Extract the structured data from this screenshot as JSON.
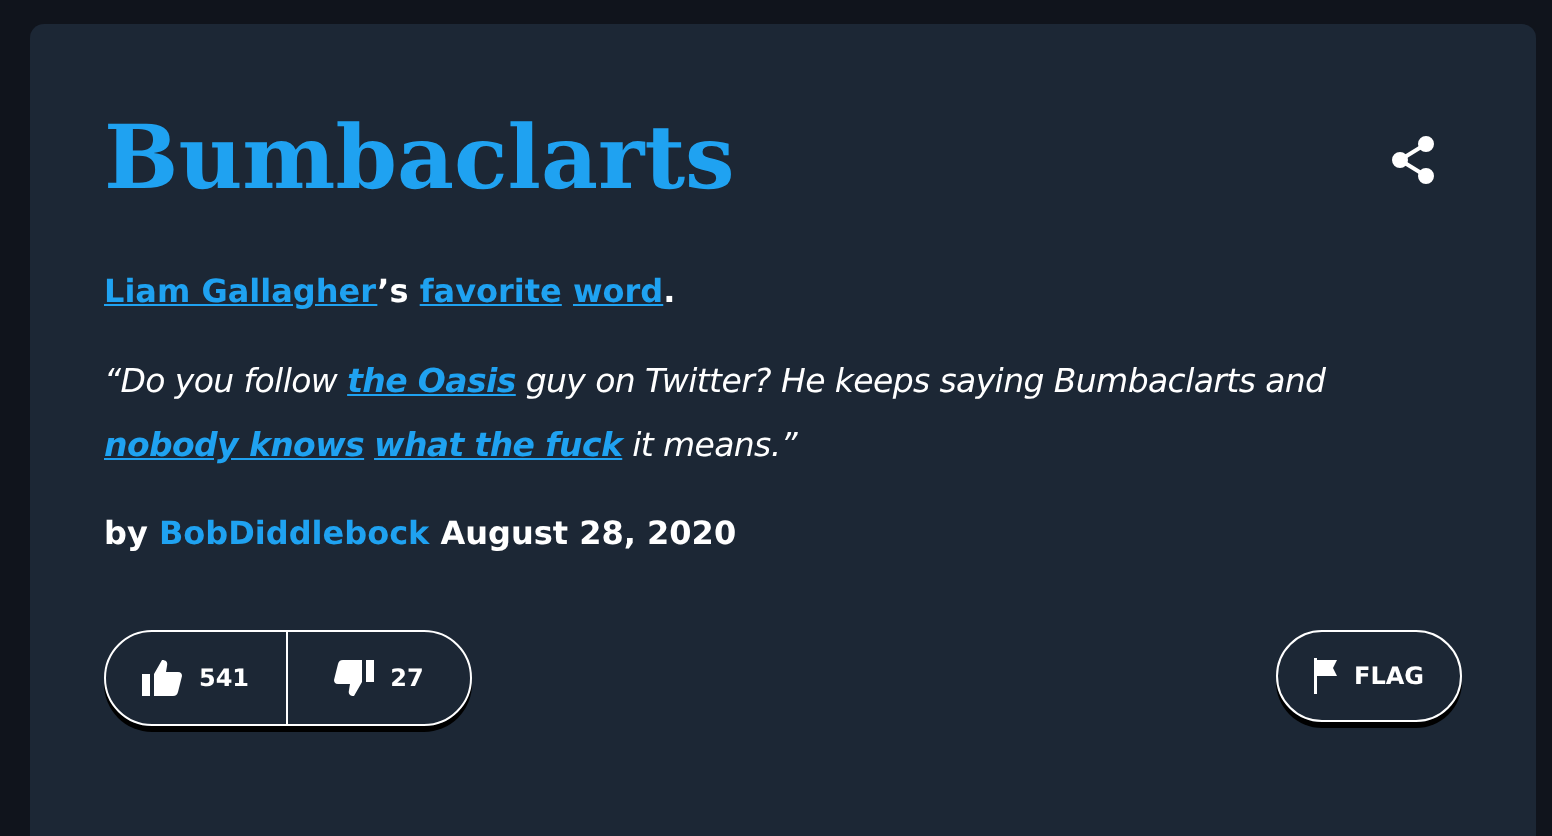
{
  "word": "Bumbaclarts",
  "meaning": [
    {
      "kind": "link",
      "text": "Liam Gallagher"
    },
    {
      "kind": "text",
      "text": "’s "
    },
    {
      "kind": "link",
      "text": "favorite"
    },
    {
      "kind": "link",
      "text": "word"
    },
    {
      "kind": "text",
      "text": "."
    }
  ],
  "example": [
    {
      "kind": "text",
      "text": "“Do you follow "
    },
    {
      "kind": "link",
      "text": "the Oasis"
    },
    {
      "kind": "text",
      "text": " guy on Twitter? He keeps saying Bumbaclarts and "
    },
    {
      "kind": "link",
      "text": "nobody knows"
    },
    {
      "kind": "link",
      "text": "what the fuck"
    },
    {
      "kind": "text",
      "text": " it means.”"
    }
  ],
  "byline": {
    "prefix": "by",
    "author": "BobDiddlebock",
    "date": "August 28, 2020"
  },
  "votes": {
    "up": "541",
    "down": "27"
  },
  "flag": "FLAG"
}
